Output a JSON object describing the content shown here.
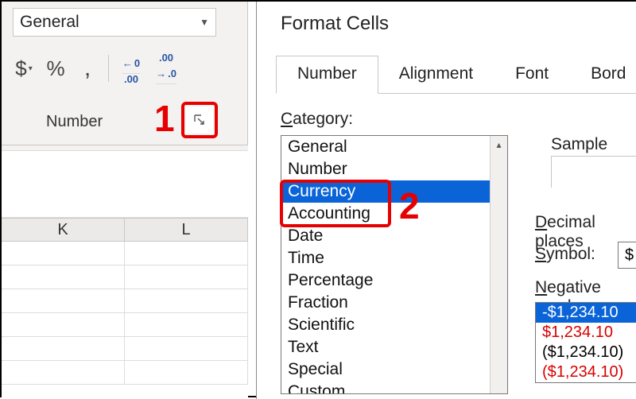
{
  "ribbon": {
    "dropdown_value": "General",
    "group_label": "Number",
    "buttons": {
      "currency": "$",
      "percent": "%",
      "comma": ",",
      "dec_inc_top": "←0",
      "dec_inc_bot": ".00",
      "dec_dec_top": ".00",
      "dec_dec_bot": "→.0"
    }
  },
  "grid": {
    "col1": "K",
    "col2": "L"
  },
  "dialog": {
    "title": "Format Cells",
    "tabs": [
      "Number",
      "Alignment",
      "Font",
      "Bord"
    ],
    "active_tab": 0,
    "category_label_pre": "C",
    "category_label_post": "ategory:",
    "categories": [
      "General",
      "Number",
      "Currency",
      "Accounting",
      "Date",
      "Time",
      "Percentage",
      "Fraction",
      "Scientific",
      "Text",
      "Special",
      "Custom"
    ],
    "selected_category_index": 2,
    "sample_label": "Sample",
    "decimal_label_pre": "D",
    "decimal_label_post": "ecimal places",
    "symbol_label_pre": "S",
    "symbol_label_post": "ymbol:",
    "symbol_value": "$",
    "negative_label_pre": "N",
    "negative_label_post": "egative numb",
    "negative_numbers": [
      "-$1,234.10",
      "$1,234.10",
      "($1,234.10)",
      "($1,234.10)"
    ],
    "negative_selected_index": 0
  },
  "annotations": {
    "num1": "1",
    "num2": "2"
  }
}
